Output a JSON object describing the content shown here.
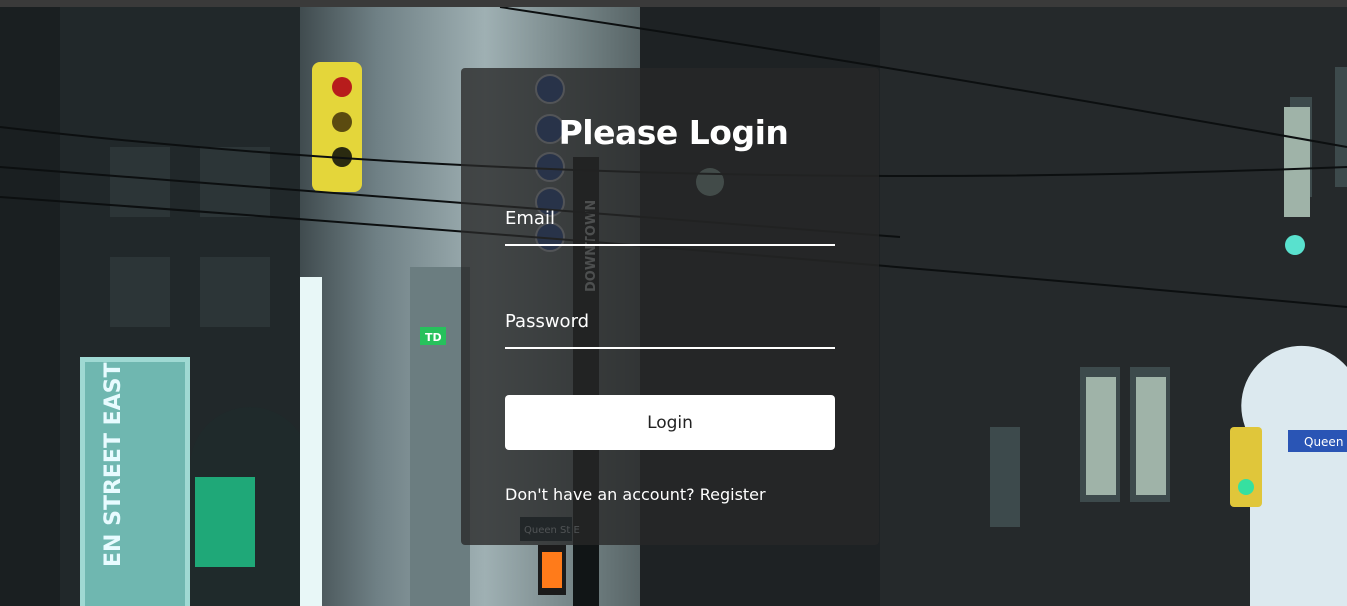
{
  "login": {
    "title": "Please Login",
    "email_label": "Email",
    "password_label": "Password",
    "button_label": "Login",
    "register_prompt": "Don't have an account?",
    "register_link": "Register"
  },
  "background": {
    "street_sign_vertical": "DOWNTOWN",
    "building_sign": "EN STREET EAST",
    "street_sign_right": "Queen",
    "street_sign_center": "Queen St E",
    "bank_logo": "TD"
  },
  "colors": {
    "card_bg": "rgba(40,40,40,0.78)",
    "text": "#ffffff",
    "button_bg": "#ffffff",
    "button_text": "#222222",
    "neon_teal": "#39e0c8"
  }
}
